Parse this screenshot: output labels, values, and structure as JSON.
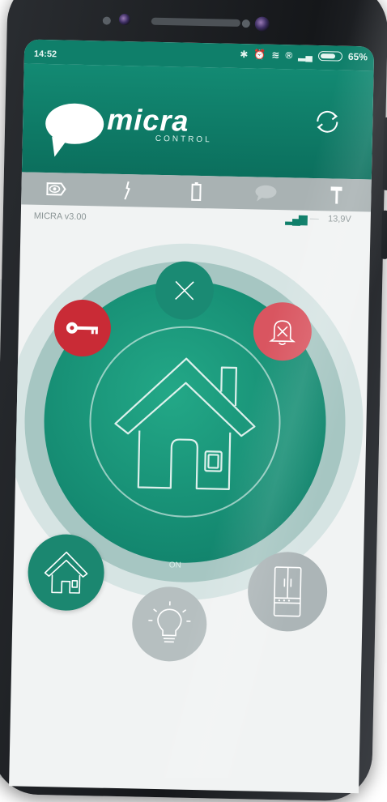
{
  "status_bar": {
    "time": "14:52",
    "battery_percent": "65%",
    "icons": [
      "bluetooth-icon",
      "alarm-icon",
      "wifi-icon",
      "roaming-icon",
      "signal-icon",
      "battery-icon"
    ]
  },
  "header": {
    "logo_text": "micra",
    "logo_subtext": "CONTROL",
    "refresh_icon": "refresh-icon"
  },
  "tabs": [
    {
      "name": "tab-view",
      "icon": "eye-icon",
      "glyph": "👁"
    },
    {
      "name": "tab-power",
      "icon": "plug-icon",
      "glyph": "⚡"
    },
    {
      "name": "tab-battery",
      "icon": "battery-icon",
      "glyph": "▯"
    },
    {
      "name": "tab-messages",
      "icon": "speech-bubble-icon",
      "glyph": "💬"
    },
    {
      "name": "tab-tools",
      "icon": "hammer-icon",
      "glyph": "⚒"
    }
  ],
  "info": {
    "version": "MICRA v3.00",
    "dash": "—",
    "voltage": "13,9V"
  },
  "main": {
    "state_label": "ON",
    "colors": {
      "accent": "#138a73",
      "alarm_red": "#c92b36",
      "bell_red": "#d95560",
      "inactive_grey": "#b6bfc0"
    }
  }
}
